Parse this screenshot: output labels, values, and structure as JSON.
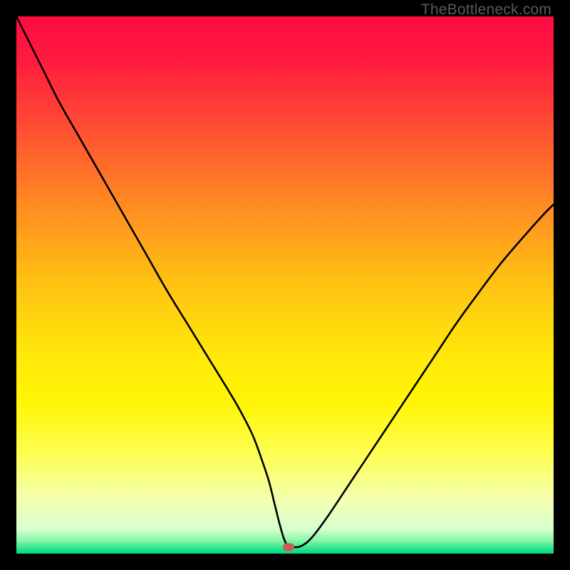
{
  "watermark": "TheBottleneck.com",
  "marker": {
    "color": "#c95b53"
  },
  "chart_data": {
    "type": "line",
    "title": "",
    "xlabel": "",
    "ylabel": "",
    "xlim": [
      0,
      100
    ],
    "ylim": [
      0,
      100
    ],
    "x": [
      0,
      2,
      5,
      8,
      12,
      16,
      20,
      24,
      28,
      32,
      36,
      40,
      42,
      44,
      45.5,
      47,
      48,
      49,
      49.8,
      50.6,
      51.5,
      53,
      55,
      58,
      62,
      66,
      70,
      74,
      78,
      82,
      86,
      90,
      94,
      98,
      100
    ],
    "y": [
      100,
      96,
      90,
      84,
      77,
      70,
      63,
      56,
      49,
      42.5,
      36,
      29.5,
      26,
      22,
      18,
      13.5,
      9.5,
      5.5,
      2.8,
      1.2,
      1.2,
      1.4,
      3,
      7,
      13,
      19,
      25,
      31,
      37,
      43,
      48.5,
      53.8,
      58.5,
      63,
      65
    ],
    "marker_point": {
      "x": 50.6,
      "y": 1.2
    },
    "background_gradient": {
      "stops": [
        {
          "pos": 0.0,
          "color": "#ff0b42"
        },
        {
          "pos": 0.08,
          "color": "#ff1a3f"
        },
        {
          "pos": 0.2,
          "color": "#ff4a33"
        },
        {
          "pos": 0.35,
          "color": "#ff8b22"
        },
        {
          "pos": 0.5,
          "color": "#ffc313"
        },
        {
          "pos": 0.62,
          "color": "#ffe60a"
        },
        {
          "pos": 0.72,
          "color": "#fff605"
        },
        {
          "pos": 0.82,
          "color": "#fdff57"
        },
        {
          "pos": 0.9,
          "color": "#f3ffb0"
        },
        {
          "pos": 0.955,
          "color": "#d7ffd0"
        },
        {
          "pos": 0.975,
          "color": "#8bf7a8"
        },
        {
          "pos": 0.993,
          "color": "#19e38a"
        },
        {
          "pos": 1.0,
          "color": "#06d989"
        }
      ]
    }
  }
}
